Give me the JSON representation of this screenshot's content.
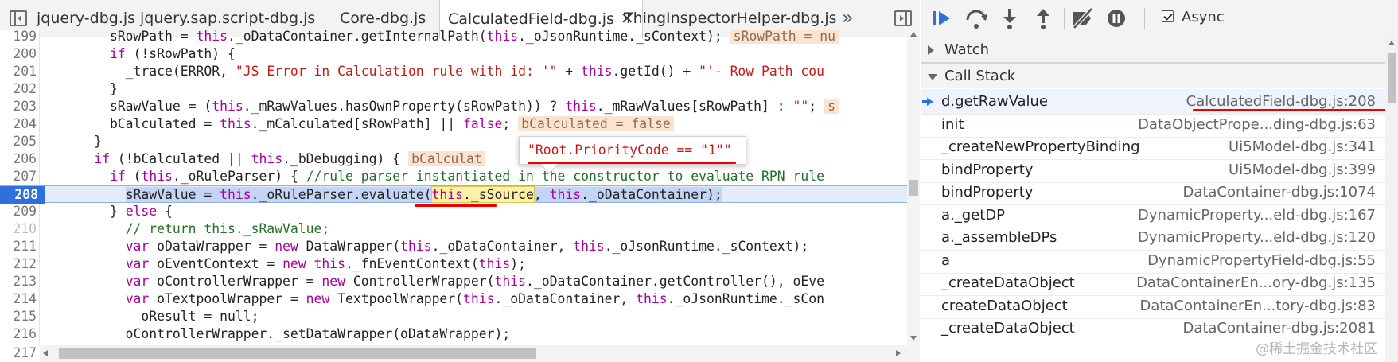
{
  "tabs": [
    {
      "label": "jquery-dbg.js",
      "active": false
    },
    {
      "label": "jquery.sap.script-dbg.js",
      "active": false
    },
    {
      "label": "Core-dbg.js",
      "active": false
    },
    {
      "label": "CalculatedField-dbg.js",
      "active": true
    },
    {
      "label": "ThingInspectorHelper-dbg.js",
      "active": false
    }
  ],
  "tab_close_glyph": "✕",
  "tab_more_glyph": "»",
  "code_lines": [
    {
      "n": "199",
      "html": "        sRowPath = <span class=\"kw\">this</span>._oDataContainer.getInternalPath(<span class=\"kw\">this</span>._oJsonRuntime._sContext);<span class=\"inline-val\">sRowPath = nu</span>"
    },
    {
      "n": "200",
      "html": "        <span class=\"kw\">if</span> (!sRowPath) {"
    },
    {
      "n": "201",
      "html": "          _trace(ERROR, <span class=\"str\">\"JS Error in Calculation rule with id: '\"</span> + <span class=\"kw\">this</span>.getId() + <span class=\"str\">\"'- Row Path cou</span>"
    },
    {
      "n": "202",
      "html": "        }"
    },
    {
      "n": "203",
      "html": "        sRawValue = (<span class=\"kw\">this</span>._mRawValues.hasOwnProperty(sRowPath)) ? <span class=\"kw\">this</span>._mRawValues[sRowPath] : <span class=\"str\">\"\"</span>;<span class=\"inline-val\">s</span>"
    },
    {
      "n": "204",
      "html": "        bCalculated = <span class=\"kw\">this</span>._mCalculated[sRowPath] || <span class=\"kw\">false</span>;<span class=\"inline-val\">bCalculated = false</span>"
    },
    {
      "n": "205",
      "html": "      }"
    },
    {
      "n": "206",
      "html": "      <span class=\"kw\">if</span> (!bCalculated || <span class=\"kw\">this</span>._bDebugging) {<span class=\"inline-val\">bCalculat</span>"
    },
    {
      "n": "207",
      "html": "        <span class=\"kw\">if</span> (<span class=\"kw\">this</span>._oRuleParser) { <span class=\"cm\">//rule parser instantiated in the constructor to evaluate RPN rule</span>"
    },
    {
      "n": "208",
      "html": "          <span class=\"sel\">sRawValue = <span class=\"kw\">this</span>._oRuleParser.evaluate(</span><span class=\"hl\"><span class=\"kw\">this</span>._sSource</span><span class=\"sel\">, <span class=\"kw\">this</span>._oDataContainer);</span>",
      "current": true
    },
    {
      "n": "209",
      "html": "        } <span class=\"kw\">else</span> {"
    },
    {
      "n": "210",
      "html": "          <span class=\"cm\">// return this._sRawValue;</span>",
      "dim": true
    },
    {
      "n": "211",
      "html": "          <span class=\"kw\">var</span> oDataWrapper = <span class=\"kw\">new</span> DataWrapper(<span class=\"kw\">this</span>._oDataContainer, <span class=\"kw\">this</span>._oJsonRuntime._sContext);"
    },
    {
      "n": "212",
      "html": "          <span class=\"kw\">var</span> oEventContext = <span class=\"kw\">new</span> <span class=\"kw\">this</span>._fnEventContext(<span class=\"kw\">this</span>);"
    },
    {
      "n": "213",
      "html": "          <span class=\"kw\">var</span> oControllerWrapper = <span class=\"kw\">new</span> ControllerWrapper(<span class=\"kw\">this</span>._oDataContainer.getController(), oEve"
    },
    {
      "n": "214",
      "html": "          <span class=\"kw\">var</span> oTextpoolWrapper = <span class=\"kw\">new</span> TextpoolWrapper(<span class=\"kw\">this</span>._oDataContainer, <span class=\"kw\">this</span>._oJsonRuntime._sCon"
    },
    {
      "n": "215",
      "html": "            oResult = null;"
    },
    {
      "n": "216",
      "html": "          oControllerWrapper._setDataWrapper(oDataWrapper);"
    }
  ],
  "bottom_line_number": "217",
  "popover_text": "\"Root.PriorityCode == \"1\"\"",
  "debugger": {
    "async_label": "Async",
    "async_checked": true,
    "watch_label": "Watch",
    "callstack_label": "Call Stack",
    "frames": [
      {
        "name": "d.getRawValue",
        "location": "CalculatedField-dbg.js:208",
        "current": true
      },
      {
        "name": "init",
        "location": "DataObjectPrope...ding-dbg.js:63"
      },
      {
        "name": "_createNewPropertyBinding",
        "location": "Ui5Model-dbg.js:341"
      },
      {
        "name": "bindProperty",
        "location": "Ui5Model-dbg.js:399"
      },
      {
        "name": "bindProperty",
        "location": "DataContainer-dbg.js:1074"
      },
      {
        "name": "a._getDP",
        "location": "DynamicProperty...eld-dbg.js:167"
      },
      {
        "name": "a._assembleDPs",
        "location": "DynamicProperty...eld-dbg.js:120"
      },
      {
        "name": "a",
        "location": "DynamicPropertyField-dbg.js:55"
      },
      {
        "name": "_createDataObject",
        "location": "DataContainerEn...ory-dbg.js:135"
      },
      {
        "name": "createDataObject",
        "location": "DataContainerEn...tory-dbg.js:83"
      },
      {
        "name": "_createDataObject",
        "location": "DataContainer-dbg.js:2081"
      }
    ]
  },
  "watermark": "@稀土掘金技术社区",
  "colors": {
    "accent": "#2f6fde",
    "annotation": "#e00000",
    "keyword": "#a9009e",
    "string": "#c41a16",
    "comment": "#236e25"
  },
  "icons": {
    "nav_left": "toggle-navigator-icon",
    "nav_right": "toggle-debugger-icon",
    "resume": "resume-icon",
    "step_over": "step-over-icon",
    "step_into": "step-into-icon",
    "step_out": "step-out-icon",
    "deactivate": "deactivate-breakpoints-icon",
    "pause_exceptions": "pause-on-exceptions-icon"
  }
}
